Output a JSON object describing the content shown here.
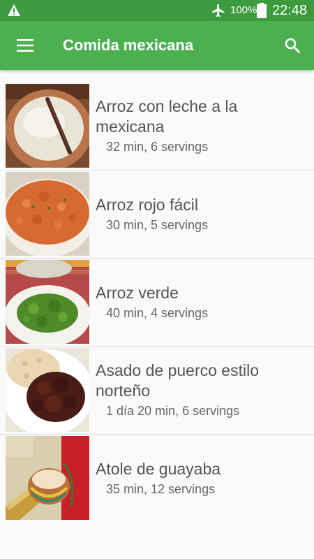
{
  "status_bar": {
    "battery_percent": "100%",
    "time": "22:48",
    "icons": [
      "warning-icon",
      "airplane-mode-icon",
      "battery-icon"
    ],
    "background_color": "#3c9a3f"
  },
  "app_bar": {
    "title": "Comida mexicana",
    "icons": [
      "menu-icon",
      "search-icon"
    ],
    "background_color": "#4caf50"
  },
  "recipes": [
    {
      "title": "Arroz con leche a la mexicana",
      "meta": "32 min, 6 servings"
    },
    {
      "title": "Arroz rojo fácil",
      "meta": "30 min, 5 servings"
    },
    {
      "title": "Arroz verde",
      "meta": "40 min, 4 servings"
    },
    {
      "title": "Asado de puerco estilo norteño",
      "meta": "1 día 20 min, 6 servings"
    },
    {
      "title": "Atole de guayaba",
      "meta": "35 min, 12 servings"
    }
  ]
}
